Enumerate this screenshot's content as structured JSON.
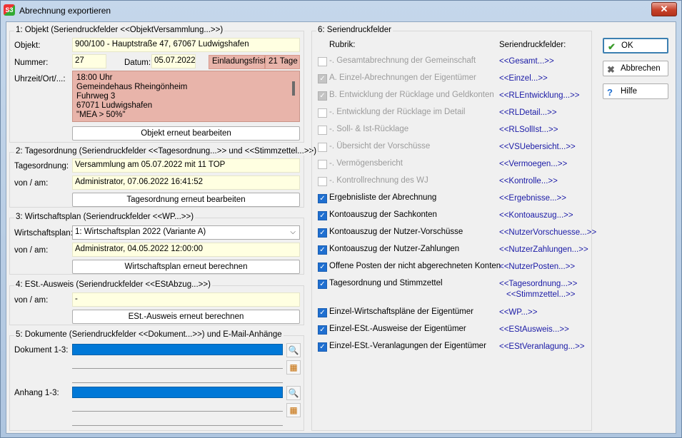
{
  "window": {
    "title": "Abrechnung exportieren",
    "app_icon_text": "S3",
    "close_symbol": "✕"
  },
  "section1": {
    "title": "1: Objekt (Seriendruckfelder <<ObjektVersammlung...>>)",
    "objekt_label": "Objekt:",
    "objekt_value": "900/100 - Hauptstraße 47, 67067 Ludwigshafen",
    "nummer_label": "Nummer:",
    "nummer_value": "27",
    "datum_label": "Datum:",
    "datum_value": "05.07.2022",
    "frist_label": "Einladungsfrist:",
    "frist_value": "21 Tage",
    "ort_label": "Uhrzeit/Ort/...:",
    "ort_lines": [
      "18:00 Uhr",
      "Gemeindehaus Rheingönheim",
      "Fuhrweg 3",
      "67071 Ludwigshafen",
      "\"MEA > 50%\""
    ],
    "button": "Objekt erneut bearbeiten"
  },
  "section2": {
    "title": "2: Tagesordnung (Seriendruckfelder <<Tagesordnung...>> und <<Stimmzettel...>>)",
    "to_label": "Tagesordnung:",
    "to_value": "Versammlung am 05.07.2022 mit 11 TOP",
    "von_label": "von / am:",
    "von_value": "Administrator,  07.06.2022 16:41:52",
    "button": "Tagesordnung erneut bearbeiten"
  },
  "section3": {
    "title": "3: Wirtschaftsplan (Seriendruckfelder <<WP...>>)",
    "wp_label": "Wirtschaftsplan:",
    "wp_value": "1: Wirtschaftsplan 2022 (Variante A)",
    "von_label": "von / am:",
    "von_value": "Administrator,  04.05.2022 12:00:00",
    "button": "Wirtschaftsplan erneut berechnen"
  },
  "section4": {
    "title": "4: ESt.-Ausweis (Seriendruckfelder <<EStAbzug...>>)",
    "von_label": "von / am:",
    "von_value": "-",
    "button": "ESt.-Ausweis erneut berechnen"
  },
  "section5": {
    "title": "5: Dokumente (Seriendruckfelder <<Dokument...>>) und E-Mail-Anhänge",
    "doc_label": "Dokument 1-3:",
    "anhang_label": "Anhang 1-3:",
    "search_symbol": "🔍",
    "calendar_symbol": "▦"
  },
  "section6": {
    "title": "6: Seriendruckfelder",
    "col_rubrik": "Rubrik:",
    "col_felder": "Seriendruckfelder:",
    "rows": [
      {
        "label": "-. Gesamtabrechnung der Gemeinschaft",
        "field": "<<Gesamt...>>",
        "checked": false,
        "disabled": true
      },
      {
        "label": "A. Einzel-Abrechnungen der Eigentümer",
        "field": "<<Einzel...>>",
        "checked": true,
        "disabled": true
      },
      {
        "label": "B. Entwicklung der Rücklage und Geldkonten",
        "field": "<<RLEntwicklung...>>",
        "checked": true,
        "disabled": true
      },
      {
        "label": "-. Entwicklung der Rücklage im Detail",
        "field": "<<RLDetail...>>",
        "checked": false,
        "disabled": true
      },
      {
        "label": "-. Soll- & Ist-Rücklage",
        "field": "<<RLSollIst...>>",
        "checked": false,
        "disabled": true
      },
      {
        "label": "-. Übersicht der Vorschüsse",
        "field": "<<VSUebersicht...>>",
        "checked": false,
        "disabled": true
      },
      {
        "label": "-. Vermögensbericht",
        "field": "<<Vermoegen...>>",
        "checked": false,
        "disabled": true
      },
      {
        "label": "-. Kontrollrechnung des WJ",
        "field": "<<Kontrolle...>>",
        "checked": false,
        "disabled": true
      },
      {
        "label": "Ergebnisliste der Abrechnung",
        "field": "<<Ergebnisse...>>",
        "checked": true,
        "disabled": false
      },
      {
        "label": "Kontoauszug der Sachkonten",
        "field": "<<Kontoauszug...>>",
        "checked": true,
        "disabled": false
      },
      {
        "label": "Kontoauszug der Nutzer-Vorschüsse",
        "field": "<<NutzerVorschuesse...>>",
        "checked": true,
        "disabled": false
      },
      {
        "label": "Kontoauszug der Nutzer-Zahlungen",
        "field": "<<NutzerZahlungen...>>",
        "checked": true,
        "disabled": false
      },
      {
        "label": "Offene Posten der nicht abgerechneten Konten",
        "field": "<<NutzerPosten...>>",
        "checked": true,
        "disabled": false
      },
      {
        "label": "Tagesordnung und Stimmzettel",
        "field": "<<Tagesordnung...>>",
        "field2": "<<Stimmzettel...>>",
        "checked": true,
        "disabled": false
      },
      {
        "label": "Einzel-Wirtschaftspläne der Eigentümer",
        "field": "<<WP...>>",
        "checked": true,
        "disabled": false
      },
      {
        "label": "Einzel-ESt.-Ausweise der Eigentümer",
        "field": "<<EStAusweis...>>",
        "checked": true,
        "disabled": false
      },
      {
        "label": "Einzel-ESt.-Veranlagungen der Eigentümer",
        "field": "<<EStVeranlagung...>>",
        "checked": true,
        "disabled": false
      }
    ]
  },
  "actions": {
    "ok": "OK",
    "cancel": "Abbrechen",
    "help": "Hilfe",
    "ok_icon": "✔",
    "cancel_icon": "✖",
    "help_icon": "?"
  },
  "colors": {
    "accent": "#0078d7",
    "field_yellow": "#ffffe1",
    "highlight_red": "#e8b4aa",
    "field_link": "#1a1aa6"
  }
}
